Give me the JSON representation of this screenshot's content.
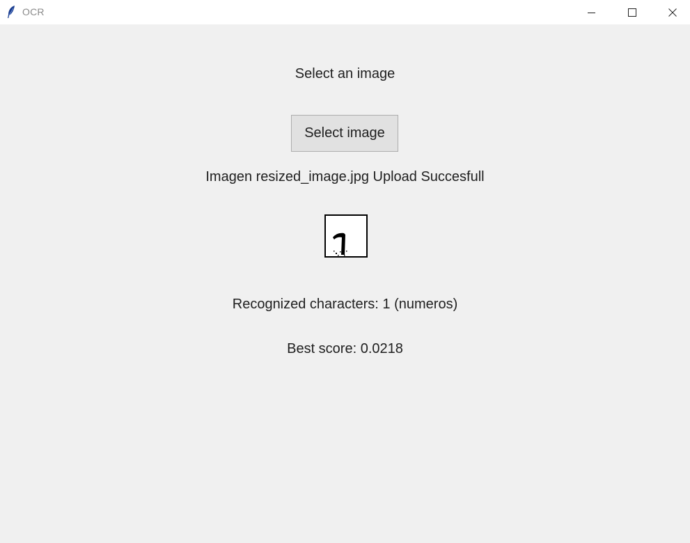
{
  "window": {
    "title": "OCR",
    "icon": "feather-icon",
    "controls": {
      "minimize_icon": "minimize-icon",
      "maximize_icon": "maximize-icon",
      "close_icon": "close-icon"
    }
  },
  "main": {
    "prompt_text": "Select an image",
    "select_button_label": "Select image",
    "upload_status": "Imagen resized_image.jpg Upload Succesfull",
    "recognized_text": "Recognized characters: 1 (numeros)",
    "score_text": "Best score: 0.0218"
  },
  "colors": {
    "background": "#f0f0f0",
    "titlebar": "#ffffff",
    "button_face": "#e1e1e1",
    "button_border": "#adadad",
    "text": "#1e1e1e"
  }
}
